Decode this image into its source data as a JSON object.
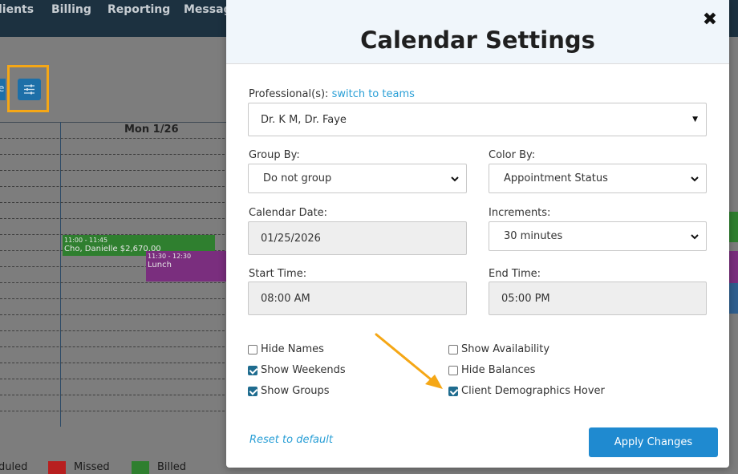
{
  "nav": {
    "items": [
      "lients",
      "Billing",
      "Reporting",
      "Messag"
    ]
  },
  "calendar": {
    "left_tab_label": "e",
    "day_header": "Mon 1/26",
    "appointments": [
      {
        "time": "11:00 - 11:45",
        "title": "Cho, Danielle $2,670.00",
        "color": "#2f7f2f"
      },
      {
        "time": "11:30 - 12:30",
        "title": "Lunch",
        "color": "#7a2e7e"
      }
    ],
    "legend": [
      {
        "label": "duled",
        "color": ""
      },
      {
        "label": "Missed",
        "color": "#b81f1f"
      },
      {
        "label": "Billed",
        "color": "#2f7f2f"
      }
    ]
  },
  "modal": {
    "title": "Calendar Settings",
    "close_icon": "close-icon",
    "professionals_label": "Professional(s):",
    "switch_link": "switch to teams",
    "professionals_value": "Dr. K M, Dr. Faye",
    "group_by_label": "Group By:",
    "group_by_value": "Do not group",
    "color_by_label": "Color By:",
    "color_by_value": "Appointment Status",
    "calendar_date_label": "Calendar Date:",
    "calendar_date_value": "01/25/2026",
    "increments_label": "Increments:",
    "increments_value": "30 minutes",
    "start_time_label": "Start Time:",
    "start_time_value": "08:00 AM",
    "end_time_label": "End Time:",
    "end_time_value": "05:00 PM",
    "checkboxes_left": [
      {
        "label": "Hide Names",
        "checked": false
      },
      {
        "label": "Show Weekends",
        "checked": true
      },
      {
        "label": "Show Groups",
        "checked": true
      }
    ],
    "checkboxes_right": [
      {
        "label": "Show Availability",
        "checked": false
      },
      {
        "label": "Hide Balances",
        "checked": false
      },
      {
        "label": "Client Demographics Hover",
        "checked": true
      }
    ],
    "reset_label": "Reset to default",
    "apply_label": "Apply Changes"
  },
  "colors": {
    "accent": "#1f8ad0",
    "link": "#2a9fd6",
    "highlight": "#f5a716",
    "checkbox": "#1f6c8f"
  }
}
